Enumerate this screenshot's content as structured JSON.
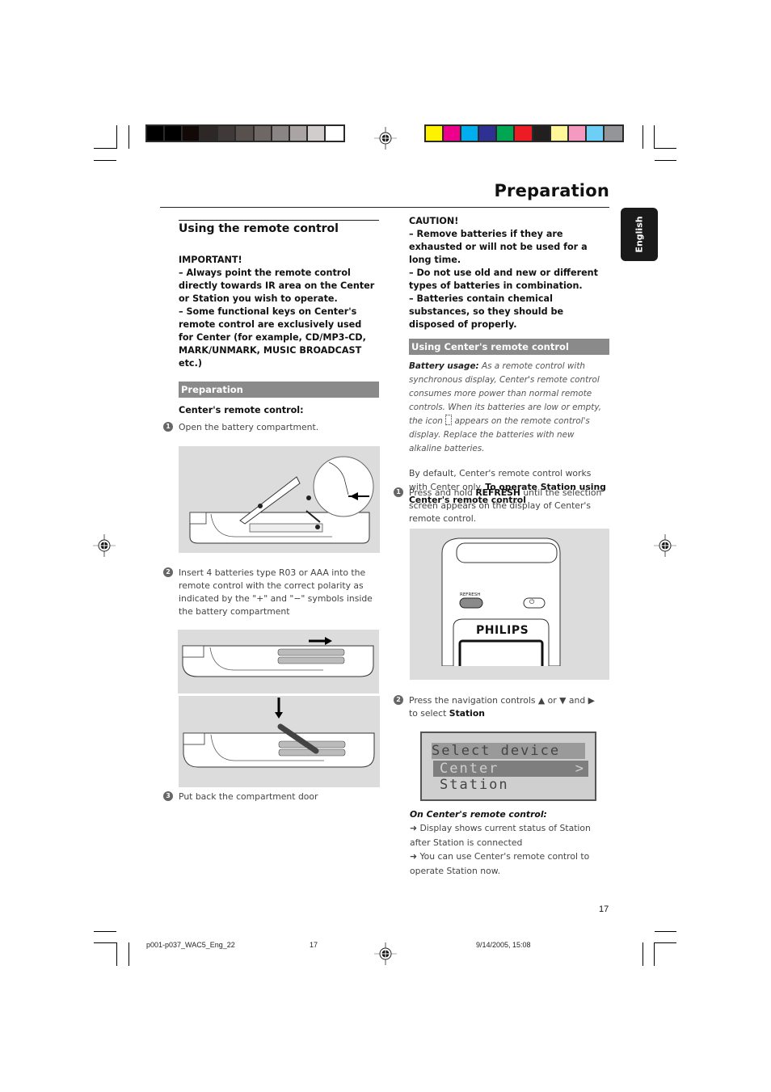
{
  "header": {
    "title": "Preparation",
    "language_tab": "English"
  },
  "color_bars": {
    "grayscale": [
      "#000000",
      "#000000",
      "#120806",
      "#2d2826",
      "#3f3a37",
      "#57504d",
      "#6e6764",
      "#8a8482",
      "#aaa5a3",
      "#d1cdcc",
      "#ffffff"
    ],
    "process": [
      "#fff200",
      "#ec008c",
      "#00aeef",
      "#2e3192",
      "#00a651",
      "#ed1c24",
      "#231f20",
      "#fff799",
      "#f49ac1",
      "#6dcff6",
      "#939598"
    ]
  },
  "left_column": {
    "heading": "Using the remote control",
    "important": {
      "label": "IMPORTANT!",
      "items": [
        "–   Always point the remote control directly towards IR area on the Center or Station you wish to operate.",
        "–   Some functional keys on Center's remote control are exclusively used for Center (for example, CD/MP3-CD, MARK/UNMARK, MUSIC BROADCAST etc.)"
      ]
    },
    "section_bar": "Preparation",
    "subheading": "Center's remote control:",
    "steps": [
      {
        "num": "1",
        "text": "Open the battery compartment."
      },
      {
        "num": "2",
        "text": "Insert 4 batteries type R03 or AAA into the remote control with the correct polarity as indicated by the \"+\" and \"−\" symbols inside the battery compartment"
      },
      {
        "num": "3",
        "text": "Put back the compartment door"
      }
    ],
    "illustrations": [
      "open-battery-compartment",
      "insert-batteries-slide",
      "insert-batteries-drop"
    ]
  },
  "right_column": {
    "caution": {
      "label": "CAUTION!",
      "items": [
        "–   Remove batteries if they are exhausted or will not be used for a long time.",
        "–   Do not use old and new or different types of batteries in combination.",
        "–   Batteries contain chemical substances, so they should be disposed of properly."
      ]
    },
    "section_bar": "Using Center's remote control",
    "battery_usage_label": "Battery usage:",
    "battery_usage_text_1": " As a remote control with synchronous display, Center's remote control consumes more power than normal remote controls. When its batteries are low or empty, the icon ",
    "battery_usage_text_2": " appears on the remote control's display. Replace the batteries with new alkaline batteries.",
    "default_text": "By default, Center's remote control works with Center only. ",
    "default_bold": "To operate Station using Center's remote control",
    "steps": [
      {
        "num": "1",
        "pre": "Press and hold ",
        "bold": "REFRESH",
        "post": " until the selection screen appears on the display of Center's remote control."
      },
      {
        "num": "2",
        "pre": "Press the navigation controls ▲  or  ▼  and ▶ to select ",
        "bold": "Station",
        "post": ""
      }
    ],
    "remote_image": {
      "refresh_label": "REFRESH",
      "power_symbol": "⏻",
      "brand": "PHILIPS"
    },
    "lcd": {
      "title": "Select device",
      "items": [
        "Center",
        "Station"
      ],
      "selected_index": 0,
      "arrow": ">"
    },
    "on_remote_label": "On Center's remote control:",
    "results": [
      "➜ Display shows current status of Station after Station is connected",
      "➜ You can use Center's remote control to operate Station now."
    ]
  },
  "page_number": "17",
  "footer": {
    "file": "p001-p037_WAC5_Eng_22",
    "page": "17",
    "timestamp": "9/14/2005, 15:08"
  }
}
